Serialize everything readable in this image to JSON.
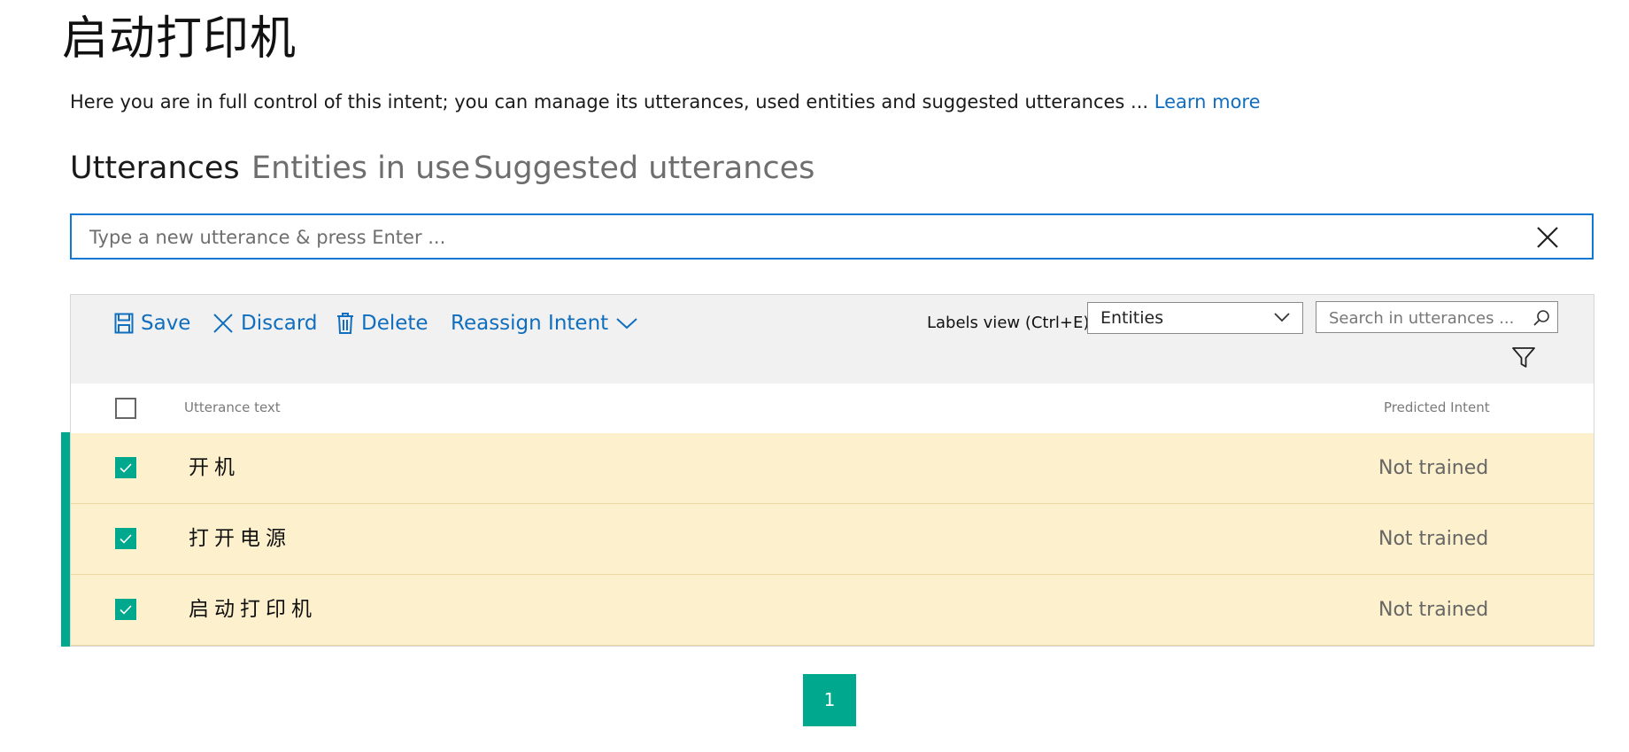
{
  "page": {
    "title": "启动打印机",
    "description": "Here you are in full control of this intent; you can manage its utterances, used entities and suggested utterances ... ",
    "learn_more": "Learn more"
  },
  "tabs": [
    {
      "label": "Utterances",
      "active": true
    },
    {
      "label": "Entities in use",
      "active": false
    },
    {
      "label": "Suggested utterances",
      "active": false
    }
  ],
  "utterance_input": {
    "placeholder": "Type a new utterance & press Enter ...",
    "value": ""
  },
  "toolbar": {
    "save_label": "Save",
    "discard_label": "Discard",
    "delete_label": "Delete",
    "reassign_label": "Reassign Intent",
    "labels_view_label": "Labels view (Ctrl+E):",
    "labels_view_value": "Entities",
    "search_placeholder": "Search in utterances ..."
  },
  "table": {
    "columns": [
      "Utterance text",
      "Predicted Intent"
    ],
    "rows": [
      {
        "utterance": "开机",
        "predicted_intent": "Not trained",
        "checked": true
      },
      {
        "utterance": "打开电源",
        "predicted_intent": "Not trained",
        "checked": true
      },
      {
        "utterance": "启动打印机",
        "predicted_intent": "Not trained",
        "checked": true
      }
    ]
  },
  "pagination": {
    "current_page": "1"
  },
  "colors": {
    "accent": "#00a88d",
    "link": "#106ebe",
    "row_highlight": "#fdf0cc",
    "input_border": "#0f78d4"
  },
  "icons": [
    "close-icon",
    "save-icon",
    "discard-icon",
    "delete-icon",
    "chevron-down-icon",
    "search-icon",
    "filter-icon",
    "checkmark-icon"
  ]
}
